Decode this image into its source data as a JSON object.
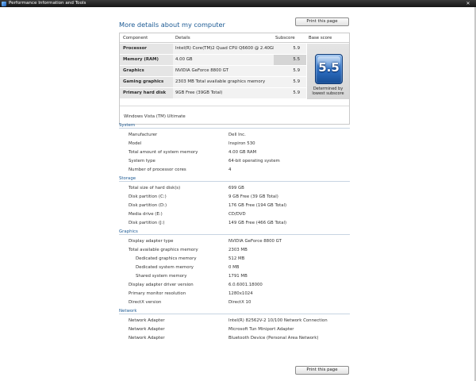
{
  "window": {
    "title": "Performance Information and Tools"
  },
  "page": {
    "title": "More details about my computer",
    "print_label": "Print this page"
  },
  "score_table": {
    "headers": {
      "component": "Component",
      "details": "Details",
      "subscore": "Subscore",
      "base_score": "Base score"
    },
    "rows": [
      {
        "component": "Processor",
        "details": "Intel(R) Core(TM)2 Quad CPU Q6600 @ 2.40GHz",
        "subscore": "5.9"
      },
      {
        "component": "Memory (RAM)",
        "details": "4.00 GB",
        "subscore": "5.5"
      },
      {
        "component": "Graphics",
        "details": "NVIDIA GeForce 8800 GT",
        "subscore": "5.9"
      },
      {
        "component": "Gaming graphics",
        "details": "2303 MB Total available graphics memory",
        "subscore": "5.9"
      },
      {
        "component": "Primary hard disk",
        "details": "9GB Free (39GB Total)",
        "subscore": "5.9"
      }
    ],
    "base_score": "5.5",
    "base_caption": "Determined by lowest subscore",
    "os": "Windows Vista (TM) Ultimate",
    "badge_color": "#2d6dc0"
  },
  "sections": {
    "system": {
      "title": "System",
      "rows": [
        {
          "label": "Manufacturer",
          "value": "Dell Inc."
        },
        {
          "label": "Model",
          "value": "Inspiron 530"
        },
        {
          "label": "Total amount of system memory",
          "value": "4.00 GB RAM"
        },
        {
          "label": "System type",
          "value": "64-bit operating system"
        },
        {
          "label": "Number of processor cores",
          "value": "4"
        }
      ]
    },
    "storage": {
      "title": "Storage",
      "rows": [
        {
          "label": "Total size of hard disk(s)",
          "value": "699 GB"
        },
        {
          "label": "Disk partition (C:)",
          "value": "9 GB Free (39 GB Total)"
        },
        {
          "label": "Disk partition (D:)",
          "value": "176 GB Free (194 GB Total)"
        },
        {
          "label": "Media drive (E:)",
          "value": "CD/DVD"
        },
        {
          "label": "Disk partition (J:)",
          "value": "149 GB Free (466 GB Total)"
        }
      ]
    },
    "graphics": {
      "title": "Graphics",
      "rows": [
        {
          "label": "Display adapter type",
          "value": "NVIDIA GeForce 8800 GT"
        },
        {
          "label": "Total available graphics memory",
          "value": "2303 MB"
        },
        {
          "label": "Dedicated graphics memory",
          "value": "512 MB"
        },
        {
          "label": "Dedicated system memory",
          "value": "0 MB"
        },
        {
          "label": "Shared system memory",
          "value": "1791 MB"
        },
        {
          "label": "Display adapter driver version",
          "value": "6.0.6001.18000"
        },
        {
          "label": "Primary monitor resolution",
          "value": "1280x1024"
        },
        {
          "label": "DirectX version",
          "value": "DirectX 10"
        }
      ]
    },
    "network": {
      "title": "Network",
      "rows": [
        {
          "label": "Network Adapter",
          "value": "Intel(R) 82562V-2 10/100 Network Connection"
        },
        {
          "label": "Network Adapter",
          "value": "Microsoft Tun Miniport Adapter"
        },
        {
          "label": "Network Adapter",
          "value": "Bluetooth Device (Personal Area Network)"
        }
      ]
    }
  }
}
